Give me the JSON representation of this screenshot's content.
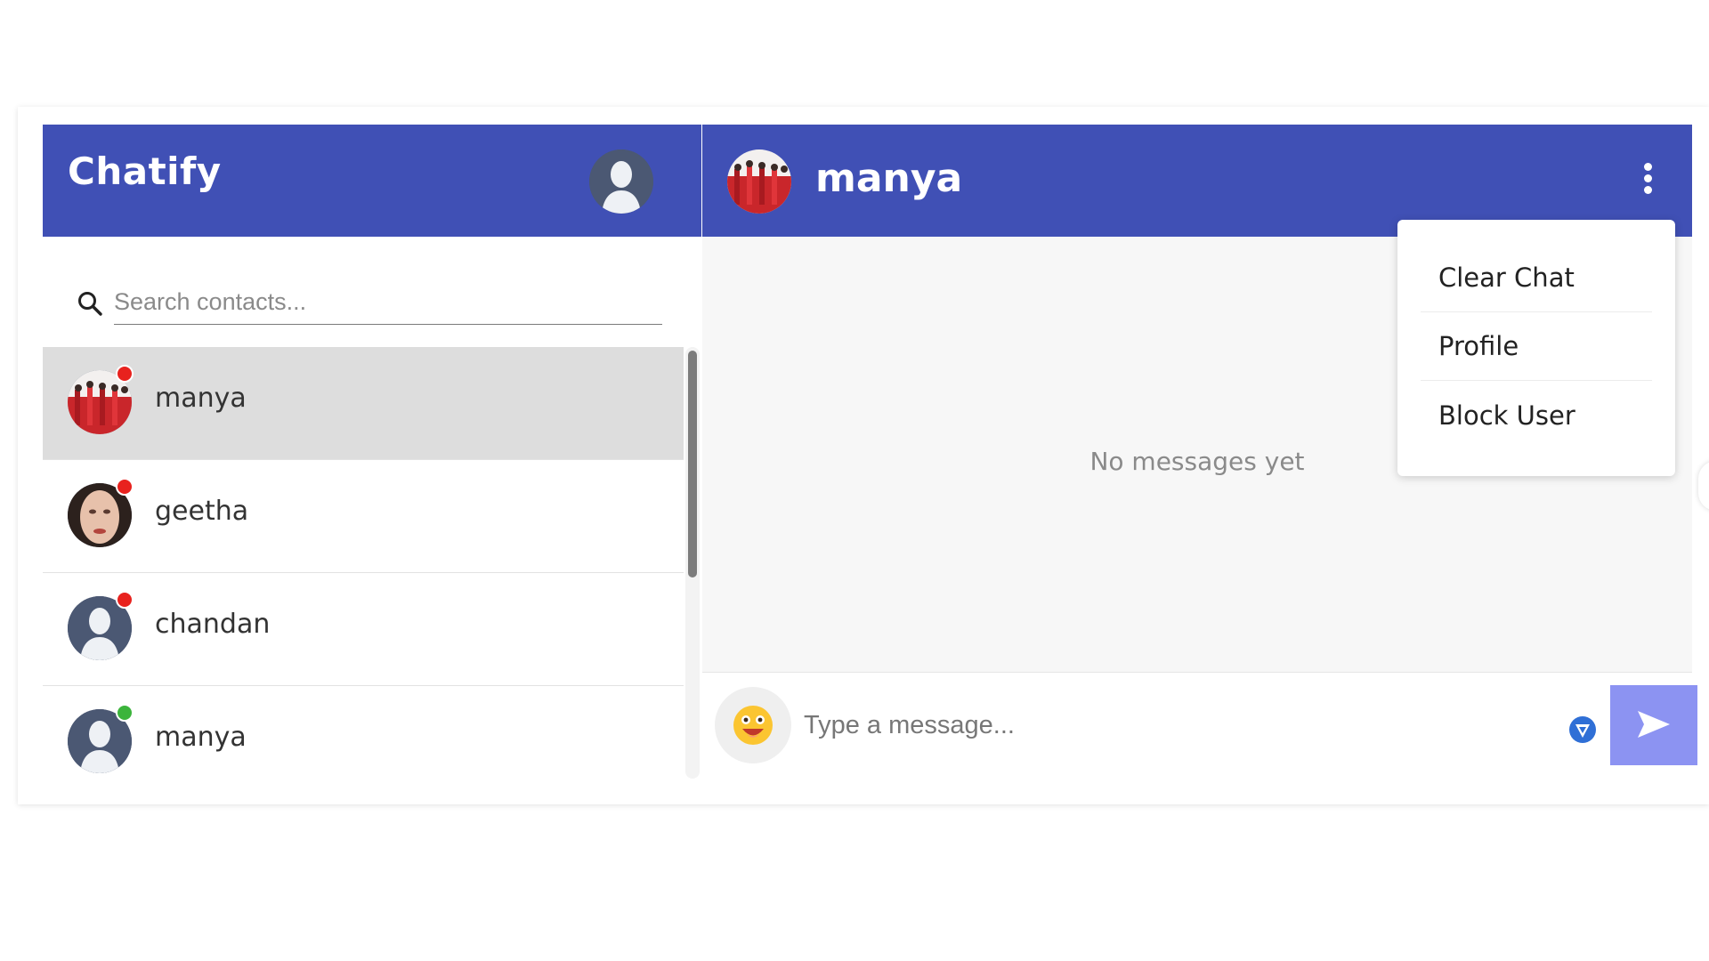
{
  "app": {
    "brand": "Chatify",
    "accent": "#4050b5"
  },
  "search": {
    "placeholder": "Search contacts..."
  },
  "contacts": [
    {
      "name": "manya",
      "status": "red",
      "avatar": "group-photo",
      "active": true
    },
    {
      "name": "geetha",
      "status": "red",
      "avatar": "face-photo",
      "active": false
    },
    {
      "name": "chandan",
      "status": "red",
      "avatar": "default-user",
      "active": false
    },
    {
      "name": "manya",
      "status": "green",
      "avatar": "default-user",
      "active": false
    }
  ],
  "chat": {
    "name": "manya",
    "empty_text": "No messages yet",
    "input_placeholder": "Type a message..."
  },
  "menu": {
    "items": [
      "Clear Chat",
      "Profile",
      "Block User"
    ]
  },
  "colors": {
    "status_red": "#e8221e",
    "status_green": "#3cb43c",
    "send_button": "#8c93f2"
  }
}
